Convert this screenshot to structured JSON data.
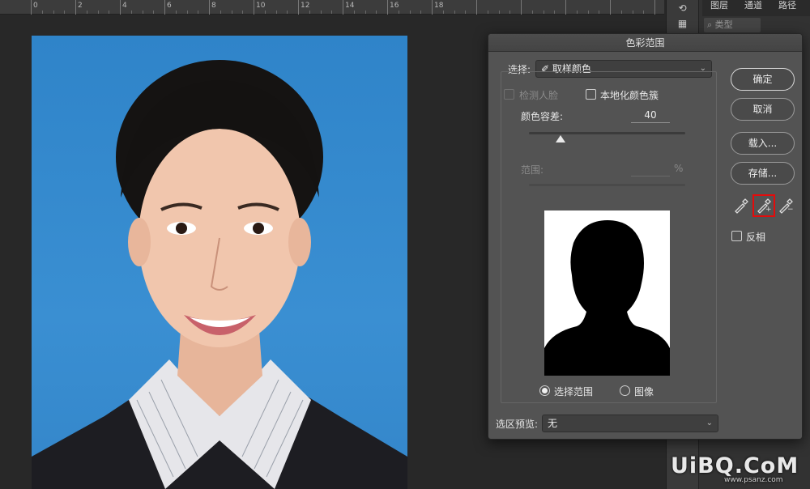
{
  "ruler": {
    "numbers": [
      "0",
      "2",
      "4",
      "6",
      "8",
      "10",
      "12",
      "14",
      "16",
      "18"
    ]
  },
  "right_panel": {
    "tabs": [
      "图层",
      "通道",
      "路径"
    ],
    "search_label": "类型",
    "history_icon": "history-icon"
  },
  "dialog": {
    "title": "色彩范围",
    "select_label": "选择:",
    "select_value": "取样颜色",
    "detect_faces_label": "检测人脸",
    "localized_clusters_label": "本地化颜色簇",
    "fuzziness_label": "颜色容差:",
    "fuzziness_value": "40",
    "fuzziness_level": 0.2,
    "range_label": "范围:",
    "range_value": "",
    "range_unit": "%",
    "view_selection_label": "选择范围",
    "view_image_label": "图像",
    "preview_label": "选区预览:",
    "preview_value": "无",
    "buttons": {
      "ok": "确定",
      "cancel": "取消",
      "load": "载入...",
      "save": "存储..."
    },
    "invert_label": "反相"
  },
  "watermark": {
    "brand": "UiBQ.CoM",
    "site": "www.psanz.com"
  },
  "colors": {
    "dialog_bg": "#535353",
    "photo_bg": "#3a8fd2",
    "highlight": "#e40b0b"
  }
}
